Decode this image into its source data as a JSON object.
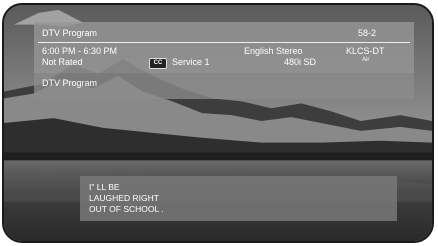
{
  "program": {
    "title": "DTV Program",
    "time_range": "6:00 PM - 6:30 PM",
    "rating": "Not Rated",
    "cc_label": "CC",
    "service": "Service 1",
    "audio": "English Stereo",
    "resolution": "480i SD",
    "channel_number": "58-2",
    "station": "KLCS-DT",
    "source": "Air",
    "description": "DTV Program"
  },
  "caption": {
    "lines": [
      "I\" LL  BE",
      "LAUGHED RIGHT",
      "OUT OF SCHOOL ."
    ]
  }
}
